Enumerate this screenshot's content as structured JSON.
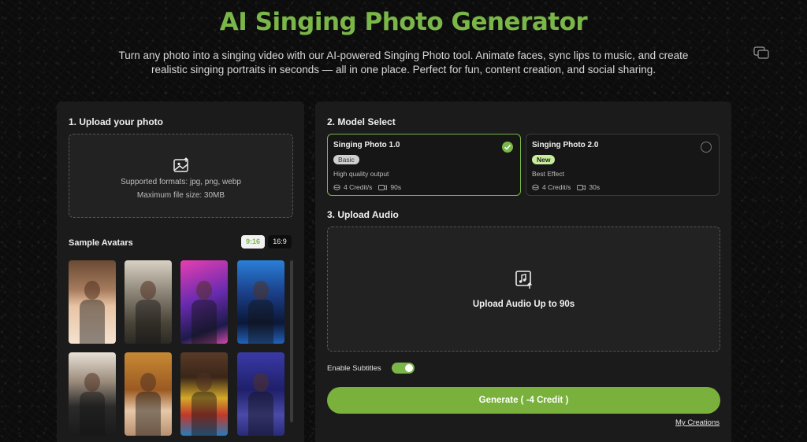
{
  "header": {
    "title": "AI Singing Photo Generator",
    "subtitle": "Turn any photo into a singing video with our AI-powered Singing Photo tool. Animate faces, sync lips to music, and create realistic singing portraits in seconds — all in one place. Perfect for fun, content creation, and social sharing."
  },
  "upload_photo": {
    "section_title": "1. Upload your photo",
    "icon": "image-upload-icon",
    "formats": "Supported formats: jpg, png, webp",
    "max_size": "Maximum file size: 30MB"
  },
  "samples": {
    "title": "Sample Avatars",
    "ratio_options": [
      "9:16",
      "16:9"
    ],
    "selected_ratio": "9:16",
    "avatars": [
      {
        "name": "avatar-woman-microphone"
      },
      {
        "name": "avatar-man-street"
      },
      {
        "name": "avatar-woman-stage-pink"
      },
      {
        "name": "avatar-woman-stage-blue"
      },
      {
        "name": "avatar-boy-guitar"
      },
      {
        "name": "avatar-girl-teddy"
      },
      {
        "name": "avatar-woman-colorful-dress"
      },
      {
        "name": "avatar-man-stage-purple"
      }
    ]
  },
  "model_select": {
    "section_title": "2. Model Select",
    "models": [
      {
        "name": "Singing Photo 1.0",
        "badge": "Basic",
        "desc": "High quality output",
        "credits": "4 Credit/s",
        "duration": "90s",
        "selected": true
      },
      {
        "name": "Singing Photo 2.0",
        "badge": "New",
        "desc": "Best Effect",
        "credits": "4 Credit/s",
        "duration": "30s",
        "selected": false
      }
    ]
  },
  "upload_audio": {
    "section_title": "3. Upload Audio",
    "icon": "music-upload-icon",
    "label": "Upload Audio Up to 90s"
  },
  "subtitles": {
    "label": "Enable Subtitles",
    "enabled": true
  },
  "actions": {
    "generate_label": "Generate ( -4 Credit )",
    "my_creations_label": "My Creations"
  },
  "colors": {
    "accent": "#7ab648",
    "panel": "#1b1b1b",
    "background": "#0c0c0c"
  }
}
